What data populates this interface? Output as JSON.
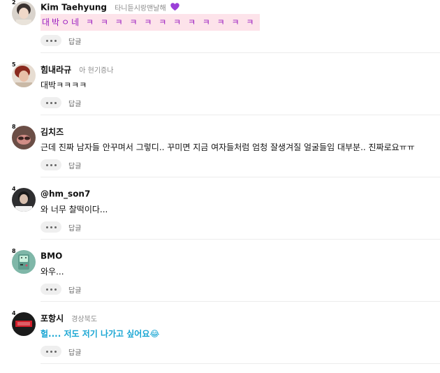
{
  "comments": [
    {
      "level": "2",
      "author": "Kim Taehyung",
      "sub": "타니듣시랑맨날해",
      "text": "대박ㅇ네 ㅋ ㅋ ㅋ ㅋ ㅋ ㅋ ㅋ ㅋ ㅋ ㅋ ㅋ ㅋ",
      "more_label": "more-options",
      "reply_label": "답글",
      "avatar_icon": "profile-photo-icon",
      "has_heart": true,
      "heart_color": "#9b3fd8"
    },
    {
      "level": "5",
      "author": "힘내라규",
      "sub": "아 현기증나",
      "text": "대박ㅋㅋㅋㅋ",
      "more_label": "more-options",
      "reply_label": "답글",
      "avatar_icon": "profile-photo-icon"
    },
    {
      "level": "8",
      "author": "김치즈",
      "sub": "",
      "text": "근데 진짜 남자들 안꾸며서 그렇디.. 꾸미면 지금 여자들처럼 엄청 잘생겨질 얼굴들임 대부분.. 진짜로요ㅠㅠ",
      "more_label": "more-options",
      "reply_label": "답글",
      "avatar_icon": "profile-photo-icon"
    },
    {
      "level": "4",
      "author": "@hm_son7",
      "sub": "",
      "text": "와 너무 찰떡이다...",
      "more_label": "more-options",
      "reply_label": "답글",
      "avatar_icon": "profile-photo-icon"
    },
    {
      "level": "8",
      "author": "BMO",
      "sub": "",
      "text": "와우...",
      "more_label": "more-options",
      "reply_label": "답글",
      "avatar_icon": "bmo-robot-icon"
    },
    {
      "level": "4",
      "author": "포항시",
      "sub": "경상북도",
      "text": "헐.... 저도 저기 나가고 싶어요",
      "emoji": "😂",
      "more_label": "more-options",
      "reply_label": "답글",
      "avatar_icon": "profile-photo-icon",
      "text_color": "#19a6d3"
    }
  ]
}
